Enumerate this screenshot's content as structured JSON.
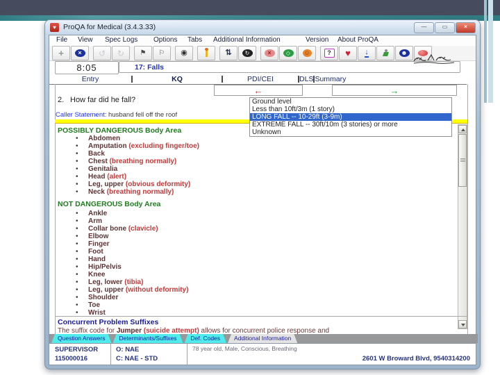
{
  "window": {
    "title": "ProQA for Medical (3.4.3.33)",
    "icon_glyph": "♥",
    "controls": {
      "minimize": "—",
      "maximize": "▭",
      "close": "×"
    }
  },
  "menu": {
    "items": [
      "File",
      "View",
      "Spec Logs",
      "Options",
      "Tabs",
      "Additional Information",
      "Version",
      "About ProQA"
    ]
  },
  "toolbar": {
    "icons": [
      {
        "name": "add-icon",
        "glyph": "+"
      },
      {
        "name": "cancel-icon",
        "glyph": "×"
      },
      {
        "name": "undo-icon",
        "glyph": "↺"
      },
      {
        "name": "redo-icon",
        "glyph": "↻"
      },
      {
        "name": "flag-icon",
        "glyph": "⚑"
      },
      {
        "name": "flag-outline-icon",
        "glyph": "⚐"
      },
      {
        "name": "target-icon",
        "glyph": "◉"
      },
      {
        "name": "candle-icon",
        "glyph": ""
      },
      {
        "name": "sort-icon",
        "glyph": "⇅"
      },
      {
        "name": "refresh-icon",
        "glyph": "↻"
      },
      {
        "name": "fan-icon",
        "glyph": "×"
      },
      {
        "name": "recycle-icon",
        "glyph": "◇"
      },
      {
        "name": "face-orange-icon",
        "glyph": "☺"
      },
      {
        "name": "help-icon",
        "glyph": "?"
      },
      {
        "name": "heart-icon",
        "glyph": "♥"
      },
      {
        "name": "pin-icon",
        "glyph": "↓"
      },
      {
        "name": "person-icon",
        "glyph": ""
      },
      {
        "name": "face-blue-icon",
        "glyph": "☻"
      },
      {
        "name": "record-icon",
        "glyph": ""
      }
    ]
  },
  "header": {
    "time": "8:05",
    "complaint": "17:  Falls"
  },
  "main_tabs": {
    "items": [
      "Entry",
      "KQ",
      "PDI/CEI",
      "DLS",
      "Summary"
    ],
    "active": "KQ"
  },
  "nav": {
    "prev": "←",
    "next": "→"
  },
  "question": {
    "number": "2.",
    "text": "How far did he fall?"
  },
  "caller": {
    "label": "Caller Statement:",
    "value": " husband fell off the roof"
  },
  "dropdown": {
    "options": [
      "Ground level",
      "Less than 10ft/3m (1 story)",
      "LONG FALL -- 10-29ft (3-9m)",
      "EXTREME FALL -- 30ft/10m (3 stories) or more",
      "Unknown"
    ],
    "selected": "LONG FALL -- 10-29ft (3-9m)",
    "selected_index": 2
  },
  "lists": {
    "possibly": {
      "title": "POSSIBLY DANGEROUS Body Area",
      "items": [
        {
          "t": "Abdomen"
        },
        {
          "t": "Amputation ",
          "p": "(excluding finger/toe)"
        },
        {
          "t": "Back"
        },
        {
          "t": "Chest ",
          "p": "(breathing normally)"
        },
        {
          "t": "Genitalia"
        },
        {
          "t": "Head ",
          "p": "(alert)"
        },
        {
          "t": "Leg, upper ",
          "p": "(obvious deformity)"
        },
        {
          "t": "Neck ",
          "p": "(breathing normally)"
        }
      ]
    },
    "not_dangerous": {
      "title": "NOT DANGEROUS Body Area",
      "items": [
        {
          "t": "Ankle"
        },
        {
          "t": "Arm"
        },
        {
          "t": "Collar bone ",
          "p": "(clavicle)"
        },
        {
          "t": "Elbow"
        },
        {
          "t": "Finger"
        },
        {
          "t": "Foot"
        },
        {
          "t": "Hand"
        },
        {
          "t": "Hip/Pelvis"
        },
        {
          "t": "Knee"
        },
        {
          "t": "Leg, lower ",
          "p": "(tibia)"
        },
        {
          "t": "Leg, upper ",
          "p": "(without deformity)"
        },
        {
          "t": "Shoulder"
        },
        {
          "t": "Toe"
        },
        {
          "t": "Wrist"
        }
      ]
    }
  },
  "suffixes": {
    "title": "Concurrent Problem Suffixes",
    "pre": "The suffix code for ",
    "term": "Jumper",
    "paren": " (suicide attempt)",
    "post": " allows for concurrent police response and"
  },
  "bottom_tabs": {
    "items": [
      "Question Answers",
      "Determinants/Suffixes",
      "Def. Codes",
      "Additional Information"
    ],
    "active": "Additional Information"
  },
  "status": {
    "operator": "SUPERVISOR",
    "case_number": "115000016",
    "omega": "O: NAE",
    "code": "C: NAE - STD",
    "patient": "78 year old, Male, Conscious, Breathing",
    "address": "2601 W Broward Blvd,  9540314200"
  },
  "colors": {
    "selection_blue": "#3166cc",
    "highlight_yellow": "#ffff00",
    "heading_green": "#1f7d1f",
    "item_maroon": "#5e3434",
    "item_red": "#c23a3a",
    "navy": "#1a1a99",
    "tab_cyan": "#50ecec",
    "slide_topbar": "#464b5d",
    "slide_teal": "#3a868c"
  }
}
